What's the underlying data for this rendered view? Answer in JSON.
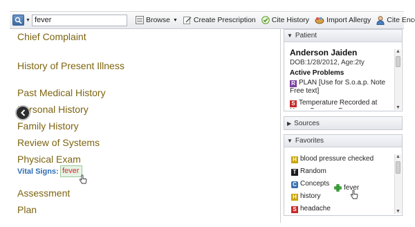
{
  "toolbar": {
    "search_value": "fever",
    "browse_label": "Browse",
    "create_prescription_label": "Create Prescription",
    "cite_history_label": "Cite History",
    "import_allergy_label": "Import Allergy",
    "cite_encounter_label": "Cite Encounter"
  },
  "note": {
    "sections": [
      "Chief Complaint",
      "History of Present Illness",
      "Past Medical History",
      "Personal History",
      "Family History",
      "Review of Systems",
      "Physical Exam",
      "Assessment",
      "Plan"
    ],
    "vital_signs_label": "Vital Signs:",
    "vital_signs_value": "fever"
  },
  "patient_panel": {
    "title": "Patient",
    "name": "Anderson Jaiden",
    "dob": "DOB:1/28/2012, Age:2ty",
    "active_problems_label": "Active Problems",
    "problems": [
      {
        "badge": "R",
        "text": "PLAN [Use for S.o.a.p. Note Free text]"
      },
      {
        "badge": "S",
        "text": "Temperature Recorded at Home Degrees F"
      }
    ]
  },
  "sources_panel": {
    "title": "Sources"
  },
  "favorites_panel": {
    "title": "Favorites",
    "items": [
      {
        "badge": "H",
        "text": "blood pressure checked"
      },
      {
        "badge": "T",
        "text": "Random"
      },
      {
        "badge": "C",
        "text": "Concepts"
      },
      {
        "badge": "H",
        "text": "history"
      },
      {
        "badge": "S",
        "text": "headache"
      }
    ],
    "drag_item": "fever"
  },
  "colors": {
    "section_text": "#7d6410",
    "vital_label": "#2f6db5",
    "vital_value": "#d12b2b",
    "badge_H": "#c9a400",
    "badge_T": "#1d1d1d",
    "badge_S": "#c62828",
    "badge_R": "#7b3fa0",
    "badge_C": "#3a6fb0"
  }
}
